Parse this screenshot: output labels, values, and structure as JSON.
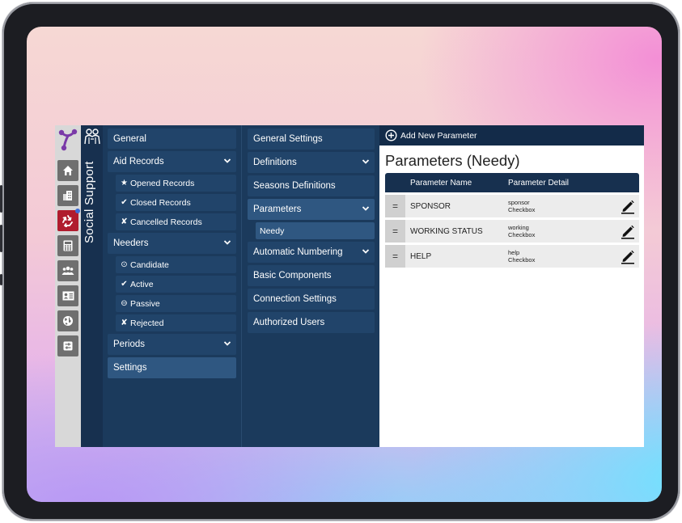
{
  "sidebar": {
    "vertical_title": "Social Support",
    "rail_icons": [
      "home-icon",
      "building-icon",
      "recycle-icon",
      "calculator-icon",
      "people-icon",
      "contact-card-icon",
      "globe-icon",
      "settings-sliders-icon"
    ]
  },
  "nav1": {
    "general": "General",
    "aid_records": "Aid Records",
    "aid_sub": [
      {
        "mark": "★",
        "label": "Opened Records"
      },
      {
        "mark": "✔",
        "label": "Closed Records"
      },
      {
        "mark": "✘",
        "label": "Cancelled Records"
      }
    ],
    "needers": "Needers",
    "needers_sub": [
      {
        "mark": "⊙",
        "label": "Candidate"
      },
      {
        "mark": "✔",
        "label": "Active"
      },
      {
        "mark": "⊖",
        "label": "Passive"
      },
      {
        "mark": "✘",
        "label": "Rejected"
      }
    ],
    "periods": "Periods",
    "settings": "Settings"
  },
  "nav2": {
    "general_settings": "General Settings",
    "definitions": "Definitions",
    "seasons_definitions": "Seasons Definitions",
    "parameters": "Parameters",
    "needy": "Needy",
    "automatic_numbering": "Automatic Numbering",
    "basic_components": "Basic Components",
    "connection_settings": "Connection Settings",
    "authorized_users": "Authorized Users"
  },
  "main": {
    "add_button": "Add New Parameter",
    "title": "Parameters (Needy)",
    "columns": [
      "Parameter Name",
      "Parameter Detail"
    ],
    "rows": [
      {
        "handle": "=",
        "name": "SPONSOR",
        "detail_code": "sponsor",
        "detail_type": "Checkbox"
      },
      {
        "handle": "=",
        "name": "WORKING STATUS",
        "detail_code": "working",
        "detail_type": "Checkbox"
      },
      {
        "handle": "=",
        "name": "HELP",
        "detail_code": "help",
        "detail_type": "Checkbox"
      }
    ]
  },
  "colors": {
    "nav_bg": "#1b3a5c",
    "nav_item": "#21446a",
    "header": "#132b49",
    "active_rail": "#b01c2e"
  }
}
